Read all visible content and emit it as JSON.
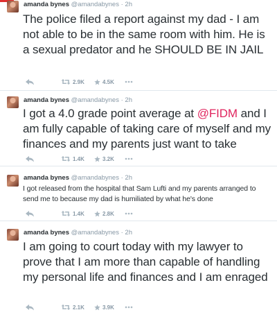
{
  "tweets": [
    {
      "name": "amanda bynes",
      "handle": "@amandabynes",
      "separator": "·",
      "time": "2h",
      "text": "The police filed a report against my dad  - I am not able to be in the same room with him. He is a sexual predator and he SHOULD BE IN JAIL",
      "retweets": "2.9K",
      "favorites": "4.5K"
    },
    {
      "name": "amanda bynes",
      "handle": "@amandabynes",
      "separator": "·",
      "time": "2h",
      "text_before": "I got a 4.0 grade point average at ",
      "mention": "@FIDM",
      "text_after": " and I am fully capable of taking care of myself and my finances and my parents just want to take",
      "retweets": "1.4K",
      "favorites": "3.2K"
    },
    {
      "name": "amanda bynes",
      "handle": "@amandabynes",
      "separator": "·",
      "time": "2h",
      "text": "I got released from the hospital that Sam Lufti and my parents arranged to send me to because my dad is humiliated by what he's done",
      "retweets": "1.4K",
      "favorites": "2.8K"
    },
    {
      "name": "amanda bynes",
      "handle": "@amandabynes",
      "separator": "·",
      "time": "2h",
      "text": "I am going to court today with my lawyer to prove that I am more than capable of handling my personal life and finances and I am enraged",
      "retweets": "2.1K",
      "favorites": "3.9K"
    }
  ],
  "icons": {
    "reply": "reply-icon",
    "retweet": "retweet-icon",
    "favorite": "star-icon",
    "more": "more-icon"
  },
  "colors": {
    "accent": "#e02f2f",
    "mention": "#e0245e",
    "meta": "#8899a6",
    "text": "#292f33"
  }
}
